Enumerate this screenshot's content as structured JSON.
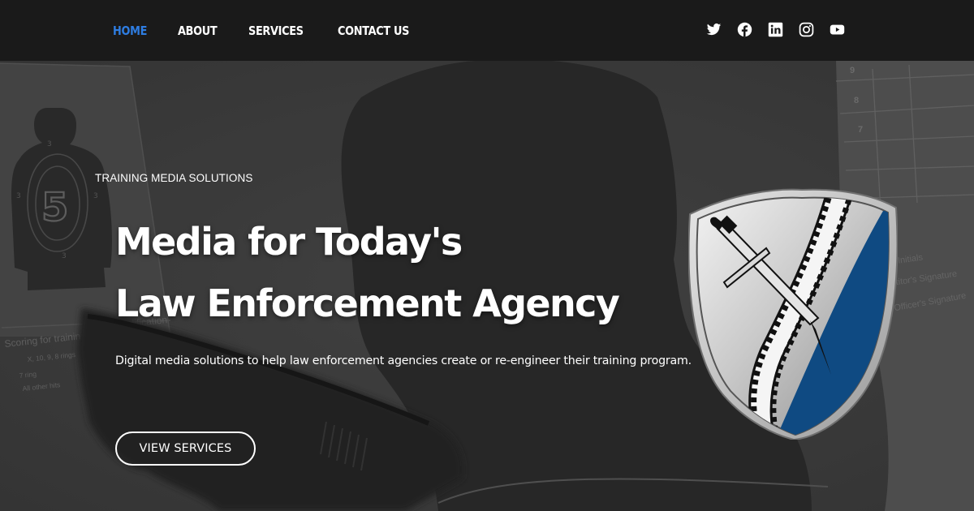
{
  "nav": {
    "items": [
      {
        "label": "HOME",
        "active": true
      },
      {
        "label": "ABOUT",
        "active": false
      },
      {
        "label": "SERVICES",
        "active": false
      },
      {
        "label": "CONTACT US",
        "active": false
      }
    ],
    "active_color": "#2e7de2",
    "social_icons": [
      "twitter-icon",
      "facebook-icon",
      "linkedin-icon",
      "instagram-icon",
      "youtube-icon"
    ]
  },
  "hero": {
    "eyebrow": "TRAINING MEDIA SOLUTIONS",
    "headline_line1": "Media for Today's",
    "headline_line2": "Law Enforcement Agency",
    "tagline": "Digital media solutions to help law enforcement agencies create or re-engineer their training program.",
    "cta_label": "VIEW SERVICES"
  },
  "background": {
    "target_number": "5",
    "target_rings": "3",
    "scoring_title": "Scoring for trainin",
    "scoring_qual": "ualification",
    "scoring_line1": "X, 10, 9, 8 rings",
    "scoring_line2": "7 ring",
    "scoring_line3": "All other hits",
    "score_rows": [
      "9",
      "8",
      "7"
    ],
    "sig_initials": "s Initials",
    "sig_competitor": "petitor's Signature",
    "sig_range": "ange Officer's Signature"
  },
  "colors": {
    "header_bg": "#1a1a1a",
    "shield_blue": "#0f4a82"
  }
}
